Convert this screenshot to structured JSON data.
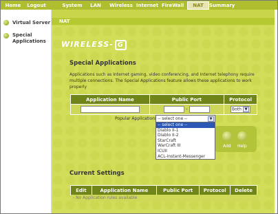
{
  "nav": {
    "tabs": [
      {
        "label": "Home"
      },
      {
        "label": "Logout"
      },
      {
        "label": "System"
      },
      {
        "label": "LAN"
      },
      {
        "label": "Wireless"
      },
      {
        "label": "Internet"
      },
      {
        "label": "FireWall"
      },
      {
        "label": "NAT"
      },
      {
        "label": "Summary"
      }
    ]
  },
  "sidebar": {
    "items": [
      {
        "label": "Virtual Server"
      },
      {
        "label": "Special"
      },
      {
        "label": "Applications"
      }
    ]
  },
  "section_bar": {
    "label": "NAT"
  },
  "logo": {
    "text": "WIRELESS-",
    "mark": "G"
  },
  "page": {
    "title": "Special Applications",
    "description": "Applications such as Internet gaming, video conferencing, and Internet telephony require multiple connections. The Special Applications feature allows these applications to work properly"
  },
  "form": {
    "headers": {
      "app_name": "Application Name",
      "public_port": "Public Port",
      "protocol": "Protocol"
    },
    "port_separator": "-",
    "protocol_value": "Both",
    "popular_label": "Popular Applications",
    "popular_selected": "-- select one --",
    "popular_options": [
      "-- select one --",
      "Diablo II-1",
      "Diablo II-2",
      "StarCraft",
      "WarCraft III",
      "ICUII",
      "ACL-Instant-Messenger"
    ],
    "add_label": "Add",
    "help_label": "Help"
  },
  "current": {
    "title": "Current Settings",
    "headers": {
      "edit": "Edit",
      "app_name": "Application Name",
      "public_port": "Public Port",
      "protocol": "Protocol",
      "delete": "Delete"
    },
    "empty_text": "- No Application rules available"
  },
  "colors": {
    "nav_bg": "#aebe2e",
    "content_bg": "#d2dd5a",
    "header_bg": "#6f8519",
    "highlight": "#2c57b4"
  }
}
